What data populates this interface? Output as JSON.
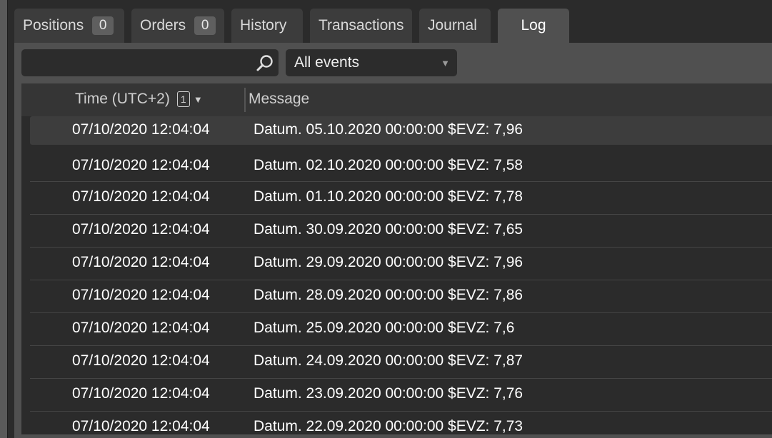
{
  "tabs": [
    {
      "label": "Positions",
      "badge": "0"
    },
    {
      "label": "Orders",
      "badge": "0"
    },
    {
      "label": "History"
    },
    {
      "label": "Transactions"
    },
    {
      "label": "Journal"
    },
    {
      "label": "Log",
      "active": true
    }
  ],
  "toolbar": {
    "search_value": "",
    "search_icon": "search-icon",
    "filter_selected": "All events"
  },
  "grid": {
    "columns": {
      "time": "Time (UTC+2)",
      "time_sort_index": "1",
      "time_sort_dir": "▼",
      "message": "Message"
    },
    "rows": [
      {
        "time": "07/10/2020 12:04:04",
        "message": "Datum. 05.10.2020 00:00:00 $EVZ: 7,96"
      },
      {
        "time": "07/10/2020 12:04:04",
        "message": "Datum. 02.10.2020 00:00:00 $EVZ: 7,58"
      },
      {
        "time": "07/10/2020 12:04:04",
        "message": "Datum. 01.10.2020 00:00:00 $EVZ: 7,78"
      },
      {
        "time": "07/10/2020 12:04:04",
        "message": "Datum. 30.09.2020 00:00:00 $EVZ: 7,65"
      },
      {
        "time": "07/10/2020 12:04:04",
        "message": "Datum. 29.09.2020 00:00:00 $EVZ: 7,96"
      },
      {
        "time": "07/10/2020 12:04:04",
        "message": "Datum. 28.09.2020 00:00:00 $EVZ: 7,86"
      },
      {
        "time": "07/10/2020 12:04:04",
        "message": "Datum. 25.09.2020 00:00:00 $EVZ: 7,6"
      },
      {
        "time": "07/10/2020 12:04:04",
        "message": "Datum. 24.09.2020 00:00:00 $EVZ: 7,87"
      },
      {
        "time": "07/10/2020 12:04:04",
        "message": "Datum. 23.09.2020 00:00:00 $EVZ: 7,76"
      },
      {
        "time": "07/10/2020 12:04:04",
        "message": "Datum. 22.09.2020 00:00:00 $EVZ: 7,73"
      }
    ]
  }
}
